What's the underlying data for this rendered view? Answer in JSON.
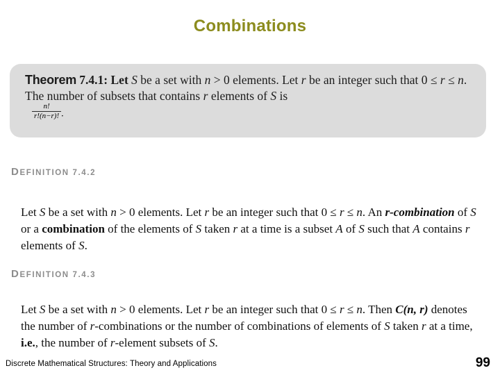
{
  "slide": {
    "title": "Combinations",
    "title_color": "#8c8c1e",
    "background_color": "#ffffff"
  },
  "theorem": {
    "box_color": "#dcdcdc",
    "label": "Theorem",
    "number": "7.4.1:",
    "line1_a": "Let ",
    "line1_var_S": "S",
    "line1_b": " be a set with ",
    "line1_var_n": "n",
    "line1_c": " > 0 elements. Let ",
    "line1_var_r": "r",
    "line1_d": " be an integer",
    "line2_a": "such that 0 ≤ ",
    "line2_var_r": "r",
    "line2_b": " ≤ ",
    "line2_var_n": "n",
    "line2_c": ". The number of subsets that contains ",
    "line2_var_r2": "r",
    "line2_d": " elements of ",
    "line2_var_S": "S",
    "line2_e": " is",
    "fraction_numerator": "n!",
    "fraction_denominator": "r!(n−r)!",
    "fraction_trailer": ".",
    "full_text": "Theorem 7.4.1: Let S be a set with n > 0 elements. Let r be an integer such that 0 ≤ r ≤ n. The number of subsets that contains r elements of S is n!/(r!(n−r)!)."
  },
  "definition_2": {
    "heading_word": "DEFINITION",
    "heading_first_letter": "D",
    "heading_rest": "EFINITION",
    "heading_number": "7.4.2",
    "heading_color": "#8c8c8c",
    "line1_a": "Let ",
    "line1_S": "S",
    "line1_b": " be a set with ",
    "line1_n": "n",
    "line1_c": " > 0 elements. Let ",
    "line1_r": "r",
    "line1_d": " be an integer such that 0 ≤ ",
    "line1_r2": "r",
    "line1_e": " ≤ ",
    "line1_n2": "n",
    "line1_f": ". An",
    "line2_bold1": "r-combination",
    "line2_a": " of ",
    "line2_S": "S",
    "line2_b": " or a ",
    "line2_bold2": "combination",
    "line2_c": " of the elements of ",
    "line2_S2": "S",
    "line2_d": " taken ",
    "line2_r": "r",
    "line2_e": " at a time is a",
    "line3_a": "subset ",
    "line3_A": "A",
    "line3_b": " of ",
    "line3_S": "S",
    "line3_c": " such that ",
    "line3_A2": "A",
    "line3_d": " contains ",
    "line3_r": "r",
    "line3_e": " elements of ",
    "line3_S2": "S",
    "line3_f": ".",
    "full_text": "Let S be a set with n > 0 elements. Let r be an integer such that 0 ≤ r ≤ n. An r-combination of S or a combination of the elements of S taken r at a time is a subset A of S such that A contains r elements of S."
  },
  "definition_3": {
    "heading_first_letter": "D",
    "heading_rest": "EFINITION",
    "heading_number": "7.4.3",
    "heading_color": "#8c8c8c",
    "line1_a": "Let ",
    "line1_S": "S",
    "line1_b": " be a set with ",
    "line1_n": "n",
    "line1_c": " > 0 elements. Let ",
    "line1_r": "r",
    "line1_d": " be an integer such that 0 ≤ ",
    "line1_r2": "r",
    "line1_e": " ≤ ",
    "line1_n2": "n",
    "line1_f": ". Then",
    "line2_bold": "C(n, r)",
    "line2_a": " denotes the number of ",
    "line2_r": "r",
    "line2_b": "-combinations or the number of combinations of",
    "line3_a": "elements of ",
    "line3_S": "S",
    "line3_b": " taken ",
    "line3_r": "r",
    "line3_c": " at a time, ",
    "line3_bold": "i.e.",
    "line3_d": ", the number of ",
    "line3_r2": "r",
    "line3_e": "-element subsets of ",
    "line3_S2": "S",
    "line3_f": ".",
    "full_text": "Let S be a set with n > 0 elements. Let r be an integer such that 0 ≤ r ≤ n. Then C(n, r) denotes the number of r-combinations or the number of combinations of elements of S taken r at a time, i.e., the number of r-element subsets of S."
  },
  "footer": {
    "text": "Discrete Mathematical Structures: Theory and Applications",
    "page_number": "99"
  }
}
